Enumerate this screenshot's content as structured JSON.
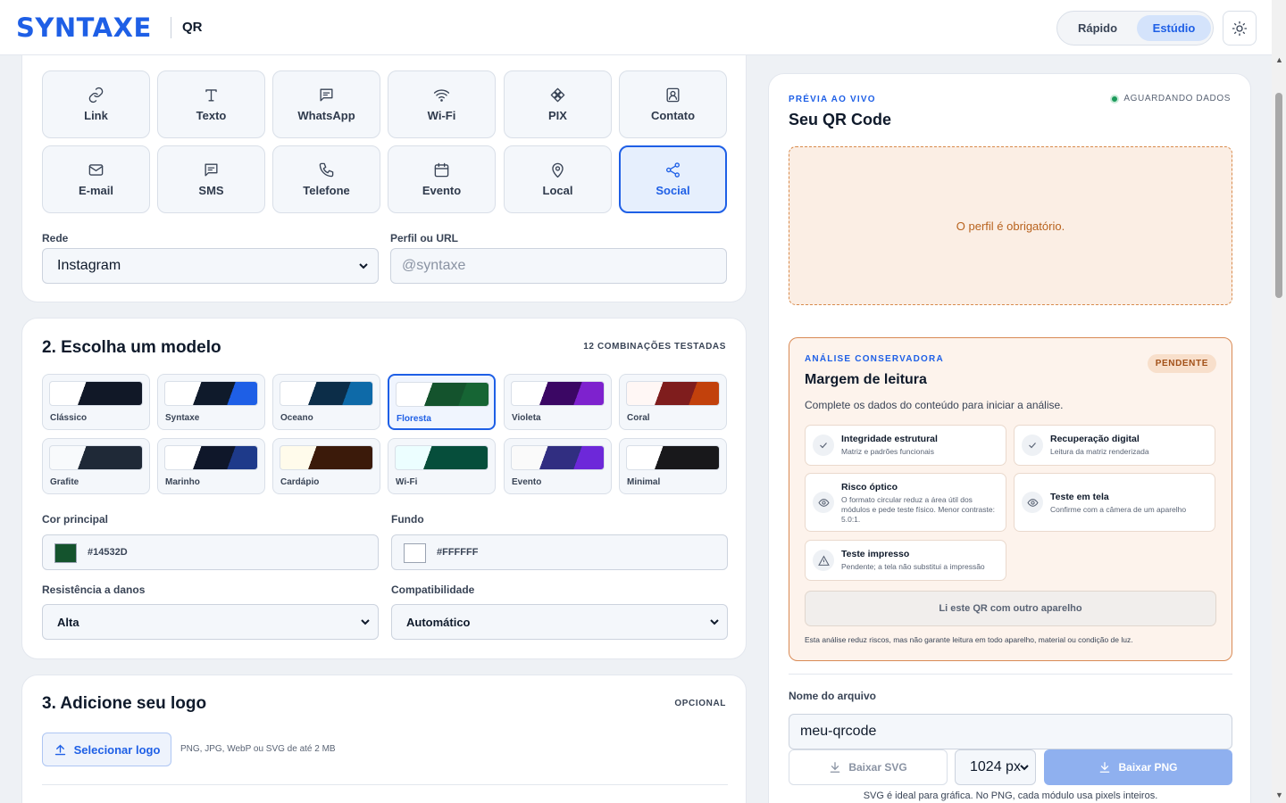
{
  "header": {
    "brand": "SYNTAXE",
    "product": "QR",
    "modes": [
      "Rápido",
      "Estúdio"
    ],
    "active_mode": "Estúdio",
    "theme_icon": "sun-icon"
  },
  "content_types": [
    {
      "label": "Link",
      "icon": "link-icon"
    },
    {
      "label": "Texto",
      "icon": "text-icon"
    },
    {
      "label": "WhatsApp",
      "icon": "chat-icon"
    },
    {
      "label": "Wi-Fi",
      "icon": "wifi-icon"
    },
    {
      "label": "PIX",
      "icon": "pix-icon"
    },
    {
      "label": "Contato",
      "icon": "contact-icon"
    },
    {
      "label": "E-mail",
      "icon": "mail-icon"
    },
    {
      "label": "SMS",
      "icon": "sms-icon"
    },
    {
      "label": "Telefone",
      "icon": "phone-icon"
    },
    {
      "label": "Evento",
      "icon": "calendar-icon"
    },
    {
      "label": "Local",
      "icon": "pin-icon"
    },
    {
      "label": "Social",
      "icon": "share-icon"
    }
  ],
  "active_type": "Social",
  "social": {
    "network_label": "Rede",
    "network_value": "Instagram",
    "profile_label": "Perfil ou URL",
    "profile_placeholder": "@syntaxe"
  },
  "templates_section": {
    "title": "2. Escolha um modelo",
    "meta": "12 COMBINAÇÕES TESTADAS",
    "active": "Floresta",
    "templates": [
      {
        "name": "Clássico",
        "light": "#ffffff",
        "dark": "#111827",
        "accent": "#111827"
      },
      {
        "name": "Syntaxe",
        "light": "#ffffff",
        "dark": "#0f1a2b",
        "accent": "#1e5fe6"
      },
      {
        "name": "Oceano",
        "light": "#ffffff",
        "dark": "#0c2d48",
        "accent": "#0e6aa8"
      },
      {
        "name": "Floresta",
        "light": "#ffffff",
        "dark": "#14532d",
        "accent": "#166534"
      },
      {
        "name": "Violeta",
        "light": "#ffffff",
        "dark": "#3b0764",
        "accent": "#7e22ce"
      },
      {
        "name": "Coral",
        "light": "#fff7f5",
        "dark": "#7f1d1d",
        "accent": "#c2410c"
      },
      {
        "name": "Grafite",
        "light": "#f8fafc",
        "dark": "#1f2937",
        "accent": "#1f2937"
      },
      {
        "name": "Marinho",
        "light": "#ffffff",
        "dark": "#0f172a",
        "accent": "#1e3a8a"
      },
      {
        "name": "Cardápio",
        "light": "#fffbeb",
        "dark": "#3b1a0a",
        "accent": "#3b1a0a"
      },
      {
        "name": "Wi-Fi",
        "light": "#ecfeff",
        "dark": "#064e3b",
        "accent": "#064e3b"
      },
      {
        "name": "Evento",
        "light": "#fafafa",
        "dark": "#312e81",
        "accent": "#6d28d9"
      },
      {
        "name": "Minimal",
        "light": "#ffffff",
        "dark": "#18181b",
        "accent": "#18181b"
      }
    ],
    "main_color_label": "Cor principal",
    "main_color": "#14532D",
    "bg_label": "Fundo",
    "bg_color": "#FFFFFF",
    "damage_label": "Resistência a danos",
    "damage_value": "Alta",
    "compat_label": "Compatibilidade",
    "compat_value": "Automático"
  },
  "logo_section": {
    "title": "3. Adicione seu logo",
    "meta": "OPCIONAL",
    "button": "Selecionar logo",
    "hint": "PNG, JPG, WebP ou SVG de até 2 MB"
  },
  "preview": {
    "kicker": "PRÉVIA AO VIVO",
    "title": "Seu QR Code",
    "status": "AGUARDANDO DADOS",
    "empty_message": "O perfil é obrigatório."
  },
  "analysis": {
    "kicker": "ANÁLISE CONSERVADORA",
    "title": "Margem de leitura",
    "badge": "PENDENTE",
    "description": "Complete os dados do conteúdo para iniciar a análise.",
    "checks": [
      {
        "title": "Integridade estrutural",
        "desc": "Matriz e padrões funcionais",
        "icon": "check-icon"
      },
      {
        "title": "Recuperação digital",
        "desc": "Leitura da matriz renderizada",
        "icon": "check-icon"
      },
      {
        "title": "Risco óptico",
        "desc": "O formato circular reduz a área útil dos módulos e pede teste físico. Menor contraste: 5.0:1.",
        "icon": "eye-icon"
      },
      {
        "title": "Teste em tela",
        "desc": "Confirme com a câmera de um aparelho",
        "icon": "eye-icon"
      },
      {
        "title": "Teste impresso",
        "desc": "Pendente; a tela não substitui a impressão",
        "icon": "warning-icon"
      }
    ],
    "read_button": "Li este QR com outro aparelho",
    "footnote": "Esta análise reduz riscos, mas não garante leitura em todo aparelho, material ou condição de luz."
  },
  "export": {
    "filename_label": "Nome do arquivo",
    "filename_value": "meu-qrcode",
    "svg_button": "Baixar SVG",
    "size_value": "1024 px",
    "png_button": "Baixar PNG",
    "note": "SVG é ideal para gráfica. No PNG, cada módulo usa pixels inteiros."
  }
}
